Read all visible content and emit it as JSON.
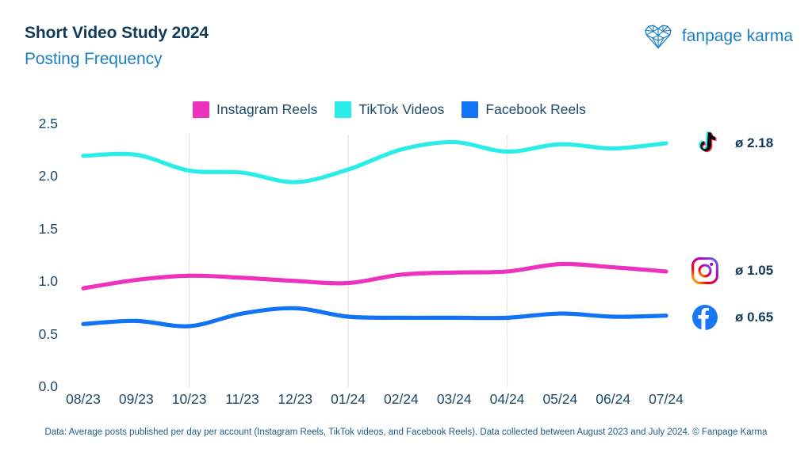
{
  "header": {
    "title": "Short Video Study 2024",
    "subtitle": "Posting Frequency",
    "brand_name": "fanpage karma",
    "brand_logo_icon": "fanpage-karma-heart-logo"
  },
  "footer": {
    "note": "Data: Average posts published per day per account (Instagram Reels, TikTok videos, and Facebook Reels). Data collected between August 2023 and July 2024. © Fanpage Karma"
  },
  "legend": {
    "position": "top-center",
    "items": [
      {
        "label": "Instagram Reels",
        "color": "#EC32BE"
      },
      {
        "label": "TikTok Videos",
        "color": "#2AEDE8"
      },
      {
        "label": "Facebook Reels",
        "color": "#1273F5"
      }
    ]
  },
  "annotations": [
    {
      "icon": "tiktok-icon",
      "series": "TikTok Videos",
      "value": "ø 2.18"
    },
    {
      "icon": "instagram-icon",
      "series": "Instagram Reels",
      "value": "ø 1.05"
    },
    {
      "icon": "facebook-icon",
      "series": "Facebook Reels",
      "value": "ø 0.65"
    }
  ],
  "colors": {
    "title": "#123A5B",
    "subtitle": "#1B7FC4",
    "axis_text": "#1C4966",
    "gridline": "#E4E7EA",
    "background": "#FFFFFF"
  },
  "chart_data": {
    "type": "line",
    "title": "Short Video Study 2024",
    "subtitle": "Posting Frequency",
    "xlabel": "",
    "ylabel": "",
    "grid": "vertical-quarterly",
    "ylim": [
      0.0,
      2.6
    ],
    "yticks": [
      "0.0",
      "0.5",
      "1.0",
      "1.5",
      "2.0",
      "2.5"
    ],
    "ytick_values": [
      0.0,
      0.5,
      1.0,
      1.5,
      2.0,
      2.5
    ],
    "categories": [
      "08/23",
      "09/23",
      "10/23",
      "11/23",
      "12/23",
      "01/24",
      "02/24",
      "03/24",
      "04/24",
      "05/24",
      "06/24",
      "07/24"
    ],
    "gridline_categories": [
      "10/23",
      "01/24",
      "04/24"
    ],
    "series": [
      {
        "name": "Instagram Reels",
        "color": "#EC32BE",
        "average": 1.05,
        "average_label": "ø 1.05",
        "values": [
          0.94,
          1.02,
          1.06,
          1.04,
          1.01,
          0.99,
          1.07,
          1.09,
          1.1,
          1.17,
          1.14,
          1.1
        ]
      },
      {
        "name": "TikTok Videos",
        "color": "#2AEDE8",
        "average": 2.18,
        "average_label": "ø 2.18",
        "values": [
          2.2,
          2.21,
          2.06,
          2.04,
          1.95,
          2.07,
          2.26,
          2.33,
          2.24,
          2.31,
          2.27,
          2.32
        ]
      },
      {
        "name": "Facebook Reels",
        "color": "#1273F5",
        "average": 0.65,
        "average_label": "ø 0.65",
        "values": [
          0.6,
          0.63,
          0.58,
          0.7,
          0.75,
          0.67,
          0.66,
          0.66,
          0.66,
          0.7,
          0.67,
          0.68
        ]
      }
    ]
  }
}
